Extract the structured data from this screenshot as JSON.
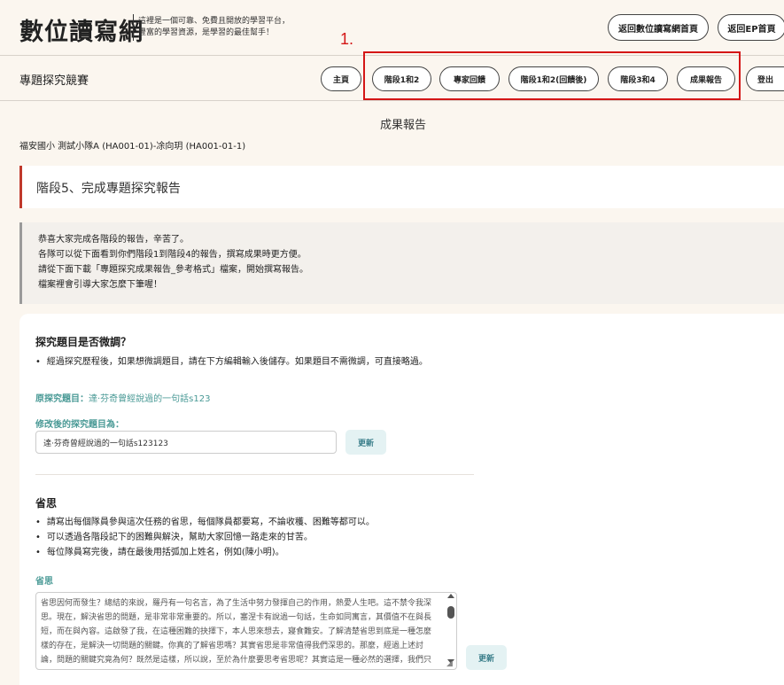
{
  "header": {
    "logo": "數位讀寫網",
    "tagline_line1": "這裡是一個可靠、免費且開放的學習平台，",
    "tagline_line2": "豐富的學習資源，是學習的最佳幫手！",
    "btn_home": "返回數位讀寫網首頁",
    "btn_ep": "返回EP首頁"
  },
  "annotation": "1.",
  "nav": {
    "title": "專題探究競賽",
    "items": [
      "主頁",
      "階段1和2",
      "專家回饋",
      "階段1和2(回饋後)",
      "階段3和4",
      "成果報告",
      "登出"
    ]
  },
  "page": {
    "heading": "成果報告",
    "team_info": "福安國小 測試小隊A (HA001-01)-凃向玥 (HA001-01-1)"
  },
  "stage": {
    "title": "階段5、完成專題探究報告"
  },
  "notice": {
    "lines": [
      "恭喜大家完成各階段的報告，辛苦了。",
      "各隊可以從下面看到你們階段1到階段4的報告，撰寫成果時更方便。",
      "請從下面下載「專題探究成果報告_參考格式」檔案，開始撰寫報告。",
      "檔案裡會引導大家怎麼下筆喔！"
    ]
  },
  "topic": {
    "title": "探究題目是否微調？",
    "bullet": "經過探究歷程後，如果想微調題目，請在下方編輯輸入後儲存。如果題目不需微調，可直接略過。",
    "orig_label": "原探究題目：",
    "orig_value": "達·芬奇曾經說過的一句話s123",
    "mod_label": "修改後的探究題目為：",
    "input_value": "達·芬奇曾經說過的一句話s123123",
    "update_label": "更新"
  },
  "reflection": {
    "title": "省思",
    "bullets": [
      "請寫出每個隊員參與這次任務的省思，每個隊員都要寫，不論收穫、困難等都可以。",
      "可以透過各階段記下的困難與解決，幫助大家回憶一路走來的甘苦。",
      "每位隊員寫完後，請在最後用括弧加上姓名，例如(陳小明)。"
    ],
    "field_label": "省思",
    "text": "省思因何而發生？總結的來說，羅丹有一句名言，為了生活中努力發揮自己的作用，熱愛人生吧。這不禁令我深思。現在，解決省思的問題，是非常非常重要的。所以，塞涅卡有說過一句話，生命如同寓言，其價值不在與長短，而在與內容。這啟發了我，在這種困難的抉擇下，本人思來想去，寢食難安。了解清楚省思到底是一種怎麼樣的存在，是解決一切問題的關鍵。你真的了解省思嗎？其實省思是非常值得我們深思的。那麼，經過上述討論，問題的關鍵究竟為何？既然是這樣，所以說，至於為什麼要思考省思呢？其實這是一種必然的選擇，我們只有正視它的存在，才能更好地解決它。",
    "update_label": "更新"
  }
}
